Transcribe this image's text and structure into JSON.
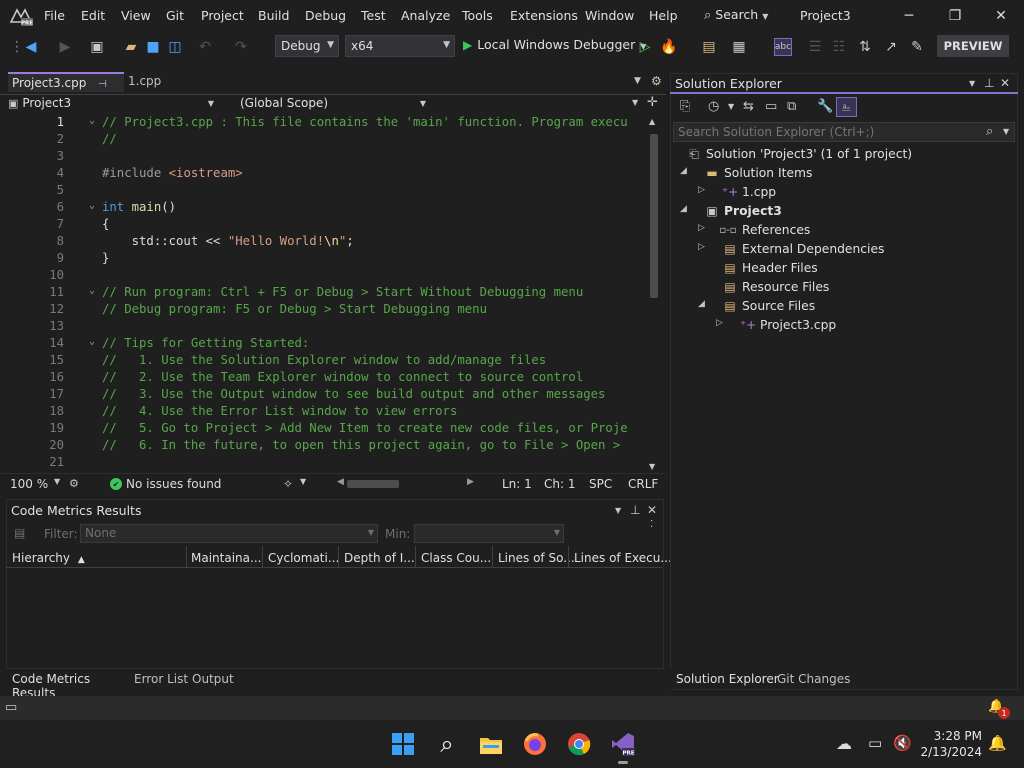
{
  "menu": {
    "items": [
      "File",
      "Edit",
      "View",
      "Git",
      "Project",
      "Build",
      "Debug",
      "Test",
      "Analyze",
      "Tools",
      "Extensions",
      "Window",
      "Help"
    ],
    "search_label": "Search",
    "project_name": "Project3"
  },
  "toolbar": {
    "config": "Debug",
    "platform": "x64",
    "debugger_label": "Local Windows Debugger",
    "preview_label": "PREVIEW"
  },
  "editor": {
    "tabs": [
      {
        "label": "Project3.cpp",
        "active": true
      },
      {
        "label": "1.cpp",
        "active": false
      }
    ],
    "nav_project": "Project3",
    "nav_scope": "(Global Scope)",
    "lines": [
      {
        "n": "1",
        "text": "// Project3.cpp : This file contains the 'main' function. Program execu"
      },
      {
        "n": "2",
        "text": "//"
      },
      {
        "n": "3",
        "text": ""
      },
      {
        "n": "4",
        "text": "#include <iostream>"
      },
      {
        "n": "5",
        "text": ""
      },
      {
        "n": "6",
        "text": "int main()"
      },
      {
        "n": "7",
        "text": "{"
      },
      {
        "n": "8",
        "text": "    std::cout << \"Hello World!\\n\";"
      },
      {
        "n": "9",
        "text": "}"
      },
      {
        "n": "10",
        "text": ""
      },
      {
        "n": "11",
        "text": "// Run program: Ctrl + F5 or Debug > Start Without Debugging menu"
      },
      {
        "n": "12",
        "text": "// Debug program: F5 or Debug > Start Debugging menu"
      },
      {
        "n": "13",
        "text": ""
      },
      {
        "n": "14",
        "text": "// Tips for Getting Started:"
      },
      {
        "n": "15",
        "text": "//   1. Use the Solution Explorer window to add/manage files"
      },
      {
        "n": "16",
        "text": "//   2. Use the Team Explorer window to connect to source control"
      },
      {
        "n": "17",
        "text": "//   3. Use the Output window to see build output and other messages"
      },
      {
        "n": "18",
        "text": "//   4. Use the Error List window to view errors"
      },
      {
        "n": "19",
        "text": "//   5. Go to Project > Add New Item to create new code files, or Proje"
      },
      {
        "n": "20",
        "text": "//   6. In the future, to open this project again, go to File > Open >"
      },
      {
        "n": "21",
        "text": ""
      }
    ],
    "status": {
      "zoom": "100 %",
      "issues": "No issues found",
      "line": "Ln: 1",
      "col": "Ch: 1",
      "spacing": "SPC",
      "eol": "CRLF"
    }
  },
  "metrics": {
    "title": "Code Metrics Results",
    "filter_label": "Filter:",
    "filter_value": "None",
    "min_label": "Min:",
    "columns": [
      "Hierarchy",
      "Maintaina...",
      "Cyclomati...",
      "Depth of I...",
      "Class Cou...",
      "Lines of So...",
      "Lines of Execu..."
    ],
    "bottom_tabs": [
      "Code Metrics Results",
      "Error List",
      "Output"
    ]
  },
  "solution_explorer": {
    "title": "Solution Explorer",
    "search_placeholder": "Search Solution Explorer (Ctrl+;)",
    "tree": [
      {
        "label": "Solution 'Project3' (1 of 1 project)",
        "expander": "",
        "bold": false
      },
      {
        "label": "Solution Items",
        "expander": "◢",
        "bold": false
      },
      {
        "label": "1.cpp",
        "expander": "▷",
        "bold": false
      },
      {
        "label": "Project3",
        "expander": "◢",
        "bold": true
      },
      {
        "label": "References",
        "expander": "▷",
        "bold": false
      },
      {
        "label": "External Dependencies",
        "expander": "▷",
        "bold": false
      },
      {
        "label": "Header Files",
        "expander": "",
        "bold": false
      },
      {
        "label": "Resource Files",
        "expander": "",
        "bold": false
      },
      {
        "label": "Source Files",
        "expander": "◢",
        "bold": false
      },
      {
        "label": "Project3.cpp",
        "expander": "▷",
        "bold": false
      }
    ],
    "bottom_tabs": [
      "Solution Explorer",
      "Git Changes"
    ]
  },
  "taskbar": {
    "time": "3:28 PM",
    "date": "2/13/2024",
    "notification_count": "1"
  },
  "colors": {
    "accent": "#8b6fd1",
    "comment": "#57a64a",
    "keyword": "#569cd6",
    "string": "#d69d85"
  }
}
